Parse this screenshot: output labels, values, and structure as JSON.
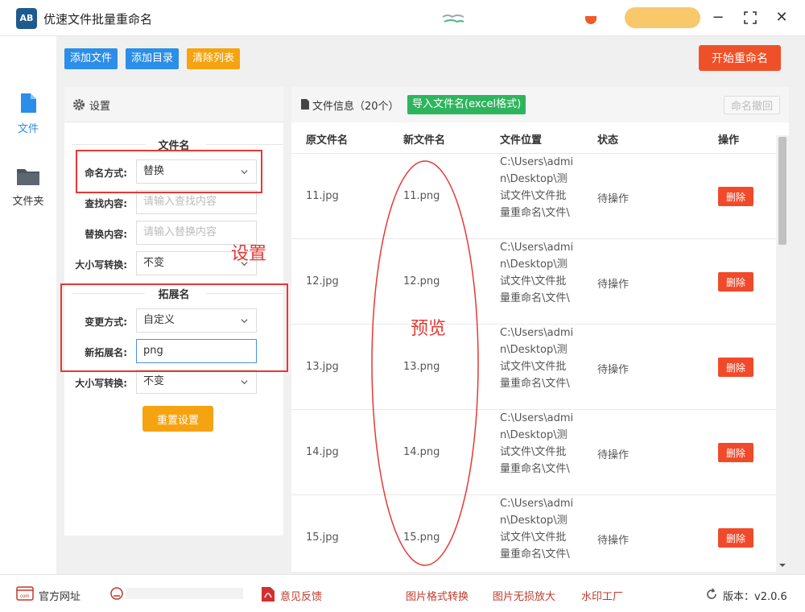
{
  "window": {
    "app_logo_text": "AB",
    "title": "优速文件批量重命名",
    "minimize": "−",
    "maximize": "⛶",
    "close": "✕"
  },
  "nav": {
    "items": [
      {
        "label": "文件",
        "icon": "file-icon"
      },
      {
        "label": "文件夹",
        "icon": "folder-icon"
      }
    ]
  },
  "toolbar": {
    "add_file": "添加文件",
    "add_dir": "添加目录",
    "clear_list": "清除列表",
    "start_rename": "开始重命名",
    "colors": {
      "blue": "#2b8ee8",
      "orange": "#f5a310",
      "red": "#f05028"
    }
  },
  "settings": {
    "title": "设置",
    "filename_section": "文件名",
    "rename_method_label": "命名方式:",
    "rename_method_value": "替换",
    "find_label": "查找内容:",
    "find_placeholder": "请输入查找内容",
    "replace_label": "替换内容:",
    "replace_placeholder": "请输入替换内容",
    "case_label": "大小写转换:",
    "case_value": "不变",
    "ext_section": "拓展名",
    "change_method_label": "变更方式:",
    "change_method_value": "自定义",
    "new_ext_label": "新拓展名:",
    "new_ext_value": "png",
    "ext_case_label": "大小写转换:",
    "ext_case_value": "不变",
    "reset_button": "重置设置"
  },
  "annotations": {
    "settings_label": "设置",
    "preview_label": "预览"
  },
  "filepanel": {
    "title": "文件信息（20个）",
    "import_button": "导入文件名(excel格式)",
    "undo_button": "命名撤回",
    "columns": [
      "原文件名",
      "新文件名",
      "文件位置",
      "状态",
      "操作"
    ],
    "rows": [
      {
        "orig": "11.jpg",
        "new": "11.png",
        "path": "C:\\Users\\admin\\Desktop\\测试文件\\文件批量重命名\\文件\\",
        "status": "待操作",
        "action": "删除"
      },
      {
        "orig": "12.jpg",
        "new": "12.png",
        "path": "C:\\Users\\admin\\Desktop\\测试文件\\文件批量重命名\\文件\\",
        "status": "待操作",
        "action": "删除"
      },
      {
        "orig": "13.jpg",
        "new": "13.png",
        "path": "C:\\Users\\admin\\Desktop\\测试文件\\文件批量重命名\\文件\\",
        "status": "待操作",
        "action": "删除"
      },
      {
        "orig": "14.jpg",
        "new": "14.png",
        "path": "C:\\Users\\admin\\Desktop\\测试文件\\文件批量重命名\\文件\\",
        "status": "待操作",
        "action": "删除"
      },
      {
        "orig": "15.jpg",
        "new": "15.png",
        "path": "C:\\Users\\admin\\Desktop\\测试文件\\文件批量重命名\\文件\\",
        "status": "待操作",
        "action": "删除"
      }
    ]
  },
  "footer": {
    "official_site": "官方网址",
    "feedback": "意见反馈",
    "image_convert": "图片格式转换",
    "image_enlarge": "图片无损放大",
    "watermark": "水印工厂",
    "version": "版本：v2.0.6"
  }
}
